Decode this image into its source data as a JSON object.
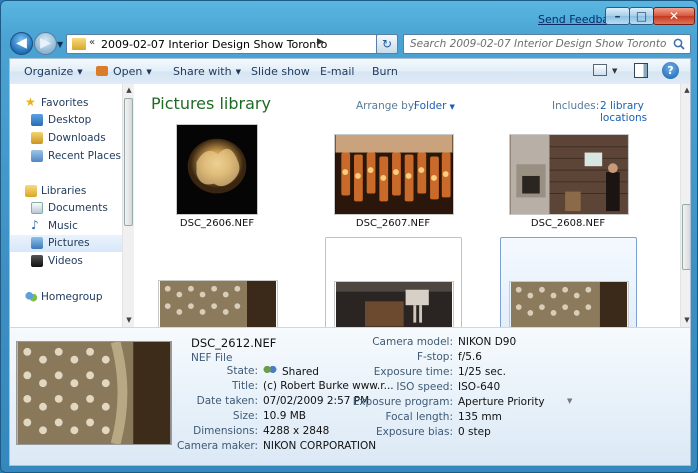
{
  "caption": {
    "send_feedback": "Send Feedback",
    "minimize": "–",
    "maximize": "□",
    "close": "✕"
  },
  "nav": {
    "back": "◀",
    "forward": "▶",
    "address_path": "2009-02-07 Interior Design Show Toronto",
    "address_chevron": "«",
    "address_sep": "▶",
    "refresh": "↻",
    "search_placeholder": "Search 2009-02-07 Interior Design Show Toronto"
  },
  "toolbar": {
    "organize": "Organize",
    "open": "Open",
    "share_with": "Share with",
    "slide_show": "Slide show",
    "email": "E-mail",
    "burn": "Burn",
    "help": "?"
  },
  "sidebar": {
    "favorites": "Favorites",
    "desktop": "Desktop",
    "downloads": "Downloads",
    "recent_places": "Recent Places",
    "libraries": "Libraries",
    "documents": "Documents",
    "music": "Music",
    "pictures": "Pictures",
    "videos": "Videos",
    "homegroup": "Homegroup"
  },
  "library": {
    "title": "Pictures library",
    "arrange_by_label": "Arrange by:",
    "arrange_by_value": "Folder",
    "includes_label": "Includes:",
    "includes_link": "2 library locations"
  },
  "files": [
    {
      "name": "DSC_2606.NEF"
    },
    {
      "name": "DSC_2607.NEF"
    },
    {
      "name": "DSC_2608.NEF"
    },
    {
      "name": ""
    },
    {
      "name": ""
    },
    {
      "name": ""
    }
  ],
  "details": {
    "name": "DSC_2612.NEF",
    "type": "NEF File",
    "state_label": "State:",
    "state_value": "Shared",
    "title_label": "Title:",
    "title_value": "(c) Robert Burke  www.r...",
    "date_label": "Date taken:",
    "date_value": "07/02/2009 2:57 PM",
    "size_label": "Size:",
    "size_value": "10.9 MB",
    "dimensions_label": "Dimensions:",
    "dimensions_value": "4288 x 2848",
    "maker_label": "Camera maker:",
    "maker_value": "NIKON CORPORATION",
    "model_label": "Camera model:",
    "model_value": "NIKON D90",
    "fstop_label": "F-stop:",
    "fstop_value": "f/5.6",
    "exposure_label": "Exposure time:",
    "exposure_value": "1/25 sec.",
    "iso_label": "ISO speed:",
    "iso_value": "ISO-640",
    "program_label": "Exposure program:",
    "program_value": "Aperture Priority",
    "focal_label": "Focal length:",
    "focal_value": "135 mm",
    "bias_label": "Exposure bias:",
    "bias_value": "0 step"
  }
}
